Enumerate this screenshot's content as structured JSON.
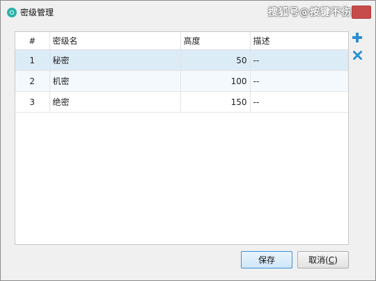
{
  "window": {
    "title": "密级管理",
    "watermark": "搜狐号@按键不伤人"
  },
  "table": {
    "columns": [
      "#",
      "密级名",
      "高度",
      "描述"
    ],
    "rows": [
      {
        "index": "1",
        "name": "秘密",
        "height": "50",
        "desc": "--"
      },
      {
        "index": "2",
        "name": "机密",
        "height": "100",
        "desc": "--"
      },
      {
        "index": "3",
        "name": "绝密",
        "height": "150",
        "desc": "--"
      }
    ],
    "selected_row": 0
  },
  "side_actions": {
    "add_icon": "plus-icon",
    "delete_icon": "x-icon",
    "add_color": "#2a8fd0",
    "delete_color": "#2a8fd0"
  },
  "buttons": {
    "save_label": "保存",
    "cancel_label": "取消(",
    "cancel_mnemonic": "C",
    "cancel_suffix": ")"
  }
}
